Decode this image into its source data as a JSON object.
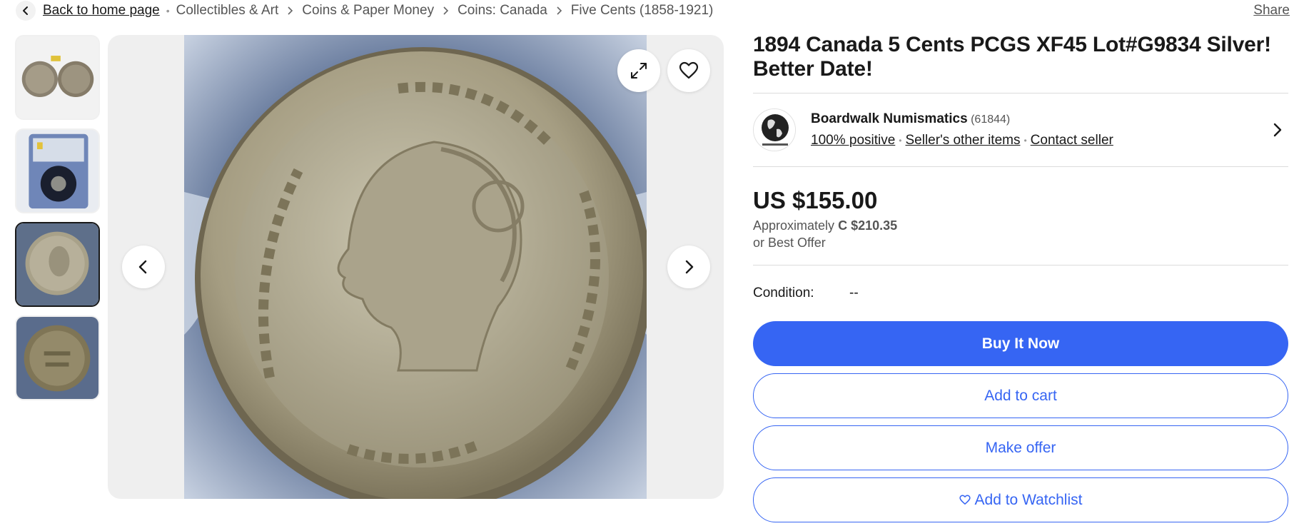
{
  "breadcrumb": {
    "back_label": "Back to home page",
    "items": [
      "Collectibles & Art",
      "Coins & Paper Money",
      "Coins: Canada",
      "Five Cents (1858-1921)"
    ],
    "share_label": "Share"
  },
  "gallery": {
    "thumbnail_count": 4,
    "active_index": 2
  },
  "listing": {
    "title": "1894 Canada 5 Cents PCGS XF45 Lot#G9834 Silver! Better Date!",
    "seller": {
      "name": "Boardwalk Numismatics",
      "feedback_count": "(61844)",
      "positive": "100% positive",
      "other_items": "Seller's other items",
      "contact": "Contact seller"
    },
    "price": "US $155.00",
    "approx_label": "Approximately",
    "approx_value": "C $210.35",
    "best_offer": "or Best Offer",
    "condition_label": "Condition:",
    "condition_value": "--"
  },
  "actions": {
    "buy_now": "Buy It Now",
    "add_to_cart": "Add to cart",
    "make_offer": "Make offer",
    "watchlist": "Add to Watchlist"
  },
  "colors": {
    "accent": "#3665f3",
    "text": "#191919",
    "muted": "#555555"
  }
}
